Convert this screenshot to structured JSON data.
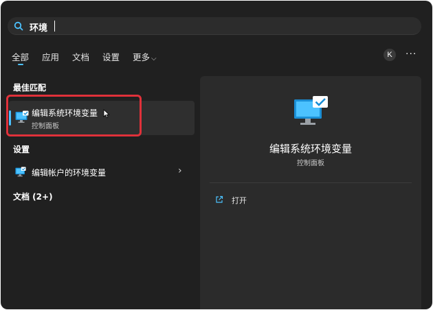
{
  "search": {
    "query": "环境"
  },
  "tabs": [
    {
      "label": "全部"
    },
    {
      "label": "应用"
    },
    {
      "label": "文档"
    },
    {
      "label": "设置"
    },
    {
      "label": "更多"
    }
  ],
  "account": {
    "initial": "K"
  },
  "more_options": "···",
  "sections": {
    "best_match": "最佳匹配",
    "settings": "设置",
    "documents": "文档 (2+)"
  },
  "best_match_item": {
    "title": "编辑系统环境变量",
    "subtitle": "控制面板"
  },
  "settings_items": [
    {
      "label": "编辑帐户的环境变量"
    }
  ],
  "preview": {
    "title": "编辑系统环境变量",
    "subtitle": "控制面板",
    "actions": [
      {
        "label": "打开"
      }
    ]
  },
  "colors": {
    "accent": "#4cc2ff",
    "highlight_border": "#e0313a",
    "background": "#202020"
  }
}
